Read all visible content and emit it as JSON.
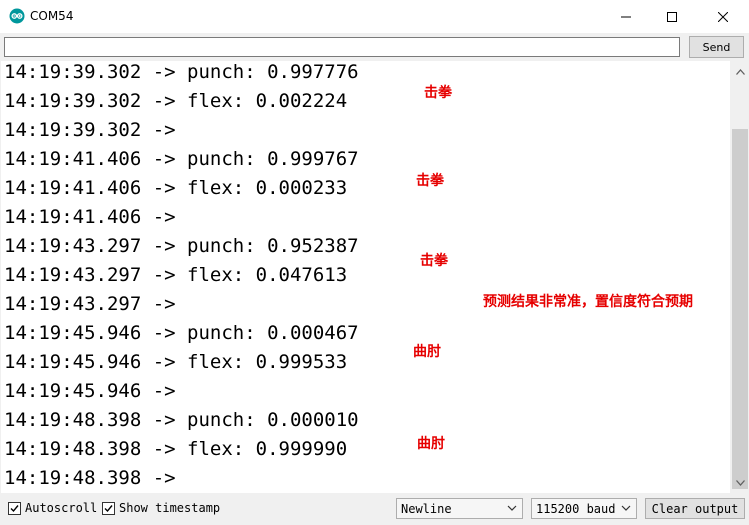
{
  "window": {
    "title": "COM54",
    "app_icon": "arduino-icon",
    "controls": [
      "minimize-icon",
      "maximize-icon",
      "close-icon"
    ]
  },
  "input": {
    "value": "",
    "send_label": "Send"
  },
  "output_lines": [
    "14:19:39.302 -> punch: 0.997776",
    "14:19:39.302 -> flex: 0.002224",
    "14:19:39.302 ->",
    "14:19:41.406 -> punch: 0.999767",
    "14:19:41.406 -> flex: 0.000233",
    "14:19:41.406 ->",
    "14:19:43.297 -> punch: 0.952387",
    "14:19:43.297 -> flex: 0.047613",
    "14:19:43.297 ->",
    "14:19:45.946 -> punch: 0.000467",
    "14:19:45.946 -> flex: 0.999533",
    "14:19:45.946 ->",
    "14:19:48.398 -> punch: 0.000010",
    "14:19:48.398 -> flex: 0.999990",
    "14:19:48.398 ->"
  ],
  "annotations": [
    "击拳",
    "击拳",
    "击拳",
    "预测结果非常准，置信度符合预期",
    "曲肘",
    "曲肘"
  ],
  "annotation_color": "#e60000",
  "footer": {
    "autoscroll_label": "Autoscroll",
    "autoscroll_checked": true,
    "timestamp_label": "Show timestamp",
    "timestamp_checked": true,
    "line_ending": "Newline",
    "baud": "115200 baud",
    "clear_label": "Clear output"
  }
}
